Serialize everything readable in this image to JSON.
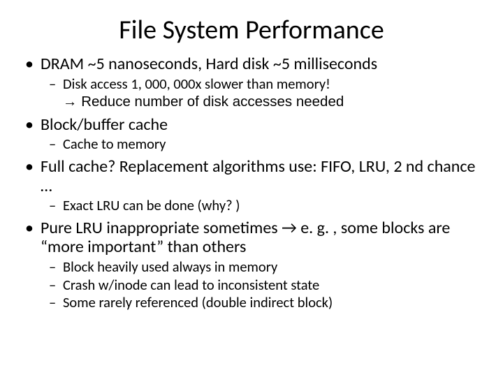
{
  "title": "File System Performance",
  "b1": "DRAM ~5 nanoseconds, Hard disk ~5 milliseconds",
  "b1s1": "Disk access 1, 000, 000x slower than memory!",
  "b1s2": "→ Reduce number of disk accesses needed",
  "b2": "Block/buffer cache",
  "b2s1": "Cache to memory",
  "b3": "Full cache?  Replacement algorithms use: FIFO, LRU, 2 nd chance …",
  "b3s1": "Exact LRU can be done (why? )",
  "b4": "Pure LRU inappropriate sometimes → e. g. , some blocks are “more important” than others",
  "b4s1": "Block heavily used always in memory",
  "b4s2": "Crash w/inode can lead to inconsistent state",
  "b4s3": "Some rarely referenced (double indirect block)"
}
